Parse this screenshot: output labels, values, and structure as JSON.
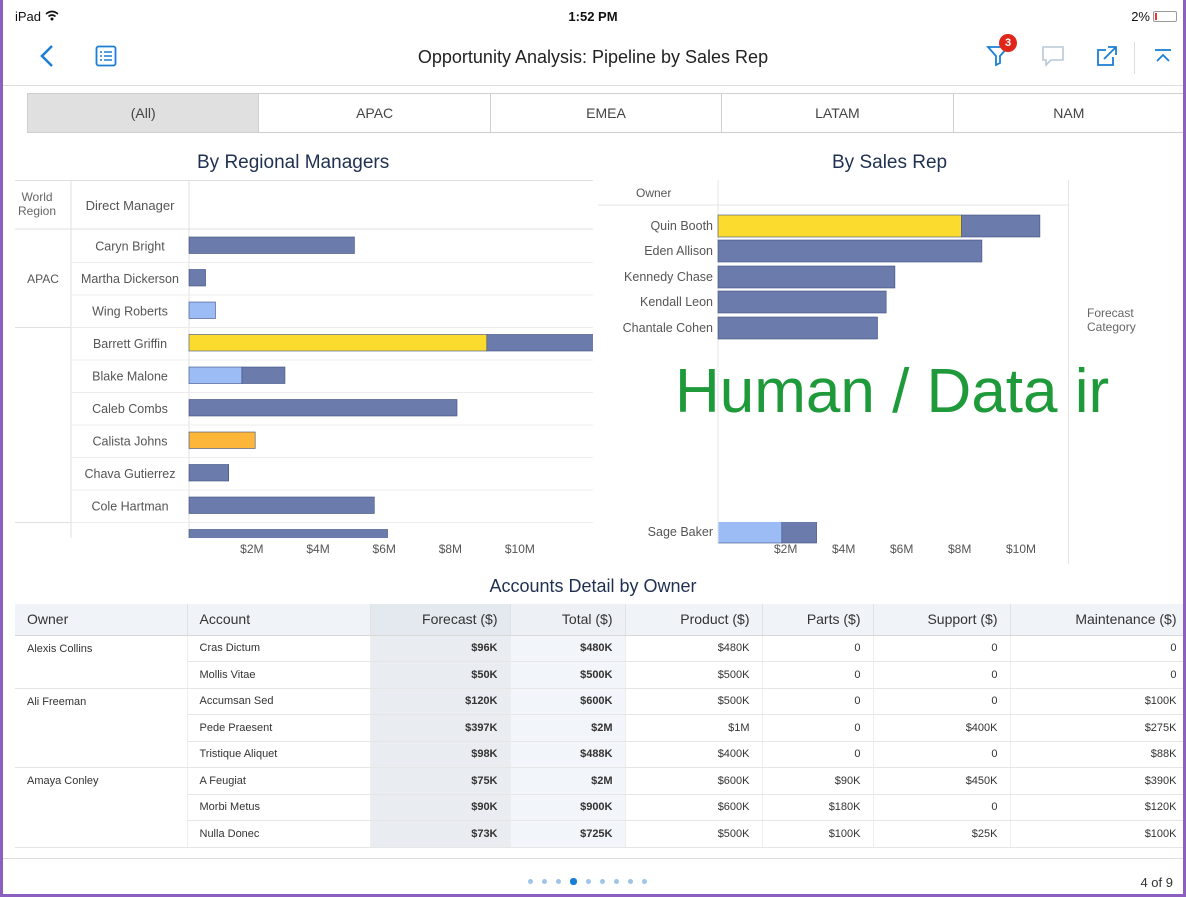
{
  "status_bar": {
    "device": "iPad",
    "time": "1:52 PM",
    "battery": "2%"
  },
  "nav": {
    "title": "Opportunity Analysis: Pipeline by Sales Rep",
    "filter_count": "3"
  },
  "segments": [
    {
      "label": "(All)",
      "selected": true
    },
    {
      "label": "APAC",
      "selected": false
    },
    {
      "label": "EMEA",
      "selected": false
    },
    {
      "label": "LATAM",
      "selected": false
    },
    {
      "label": "NAM",
      "selected": false
    }
  ],
  "colors": {
    "committed": "#6b7bab",
    "upside": "#fcdb2f",
    "pipeline": "#9bbcf4",
    "best_case": "#fdb53a",
    "accent": "#1a7fd4"
  },
  "chart_data": [
    {
      "type": "bar",
      "title": "By Regional Managers",
      "orientation": "horizontal",
      "stacked": true,
      "row_headers": [
        "World Region",
        "Direct Manager"
      ],
      "groups": [
        {
          "region": "APAC",
          "managers": [
            "Caryn Bright",
            "Martha Dickerson",
            "Wing Roberts"
          ]
        },
        {
          "region": "",
          "managers": [
            "Barrett Griffin",
            "Blake Malone",
            "Caleb Combs",
            "Calista Johns",
            "Chava Gutierrez",
            "Cole Hartman"
          ]
        }
      ],
      "categories": [
        "Caryn Bright",
        "Martha Dickerson",
        "Wing Roberts",
        "Barrett Griffin",
        "Blake Malone",
        "Caleb Combs",
        "Calista Johns",
        "Chava Gutierrez",
        "Cole Hartman",
        ""
      ],
      "bars": [
        [
          {
            "value": 5.0,
            "color": "committed"
          }
        ],
        [
          {
            "value": 0.5,
            "color": "committed"
          }
        ],
        [
          {
            "value": 0.8,
            "color": "pipeline"
          }
        ],
        [
          {
            "value": 9.0,
            "color": "upside"
          },
          {
            "value": 3.5,
            "color": "committed"
          }
        ],
        [
          {
            "value": 1.6,
            "color": "pipeline"
          },
          {
            "value": 1.3,
            "color": "committed"
          }
        ],
        [
          {
            "value": 8.1,
            "color": "committed"
          }
        ],
        [
          {
            "value": 2.0,
            "color": "best_case"
          }
        ],
        [
          {
            "value": 1.2,
            "color": "committed"
          }
        ],
        [
          {
            "value": 5.6,
            "color": "committed"
          }
        ],
        [
          {
            "value": 6.0,
            "color": "committed"
          }
        ]
      ],
      "xticks": [
        "$2M",
        "$4M",
        "$6M",
        "$8M",
        "$10M"
      ],
      "xlim": [
        0,
        12
      ]
    },
    {
      "type": "bar",
      "title": "By Sales Rep",
      "orientation": "horizontal",
      "stacked": true,
      "column_header": "Owner",
      "categories": [
        "Quin Booth",
        "Eden Allison",
        "Kennedy Chase",
        "Kendall Leon",
        "Chantale Cohen",
        "Sage Baker"
      ],
      "bars": [
        [
          {
            "value": 8.4,
            "color": "upside"
          },
          {
            "value": 2.7,
            "color": "committed"
          }
        ],
        [
          {
            "value": 9.1,
            "color": "committed"
          }
        ],
        [
          {
            "value": 6.1,
            "color": "committed"
          }
        ],
        [
          {
            "value": 5.8,
            "color": "committed"
          }
        ],
        [
          {
            "value": 5.5,
            "color": "committed"
          }
        ],
        [
          {
            "value": 2.2,
            "color": "pipeline"
          },
          {
            "value": 1.2,
            "color": "committed"
          }
        ]
      ],
      "xticks": [
        "$2M",
        "$4M",
        "$6M",
        "$8M",
        "$10M"
      ],
      "xlim": [
        0,
        12
      ],
      "legend_title": "Forecast Category",
      "legend_position": "right"
    }
  ],
  "overlay_text": "Human / Data ir",
  "detail": {
    "title": "Accounts Detail by Owner",
    "columns": [
      "Owner",
      "Account",
      "Forecast ($)",
      "Total ($)",
      "Product ($)",
      "Parts ($)",
      "Support ($)",
      "Maintenance ($)"
    ],
    "rows": [
      {
        "owner": "Alexis Collins",
        "account": "Cras Dictum",
        "forecast": "$96K",
        "total": "$480K",
        "product": "$480K",
        "parts": "0",
        "support": "0",
        "maintenance": "0"
      },
      {
        "owner": "",
        "account": "Mollis Vitae",
        "forecast": "$50K",
        "total": "$500K",
        "product": "$500K",
        "parts": "0",
        "support": "0",
        "maintenance": "0"
      },
      {
        "owner": "Ali Freeman",
        "account": "Accumsan Sed",
        "forecast": "$120K",
        "total": "$600K",
        "product": "$500K",
        "parts": "0",
        "support": "0",
        "maintenance": "$100K"
      },
      {
        "owner": "",
        "account": "Pede Praesent",
        "forecast": "$397K",
        "total": "$2M",
        "product": "$1M",
        "parts": "0",
        "support": "$400K",
        "maintenance": "$275K"
      },
      {
        "owner": "",
        "account": "Tristique Aliquet",
        "forecast": "$98K",
        "total": "$488K",
        "product": "$400K",
        "parts": "0",
        "support": "0",
        "maintenance": "$88K"
      },
      {
        "owner": "Amaya Conley",
        "account": "A Feugiat",
        "forecast": "$75K",
        "total": "$2M",
        "product": "$600K",
        "parts": "$90K",
        "support": "$450K",
        "maintenance": "$390K"
      },
      {
        "owner": "",
        "account": "Morbi Metus",
        "forecast": "$90K",
        "total": "$900K",
        "product": "$600K",
        "parts": "$180K",
        "support": "0",
        "maintenance": "$120K"
      },
      {
        "owner": "",
        "account": "Nulla Donec",
        "forecast": "$73K",
        "total": "$725K",
        "product": "$500K",
        "parts": "$100K",
        "support": "$25K",
        "maintenance": "$100K"
      }
    ]
  },
  "footer": {
    "page_info": "4 of 9",
    "page_count": 9,
    "current_page": 4
  }
}
